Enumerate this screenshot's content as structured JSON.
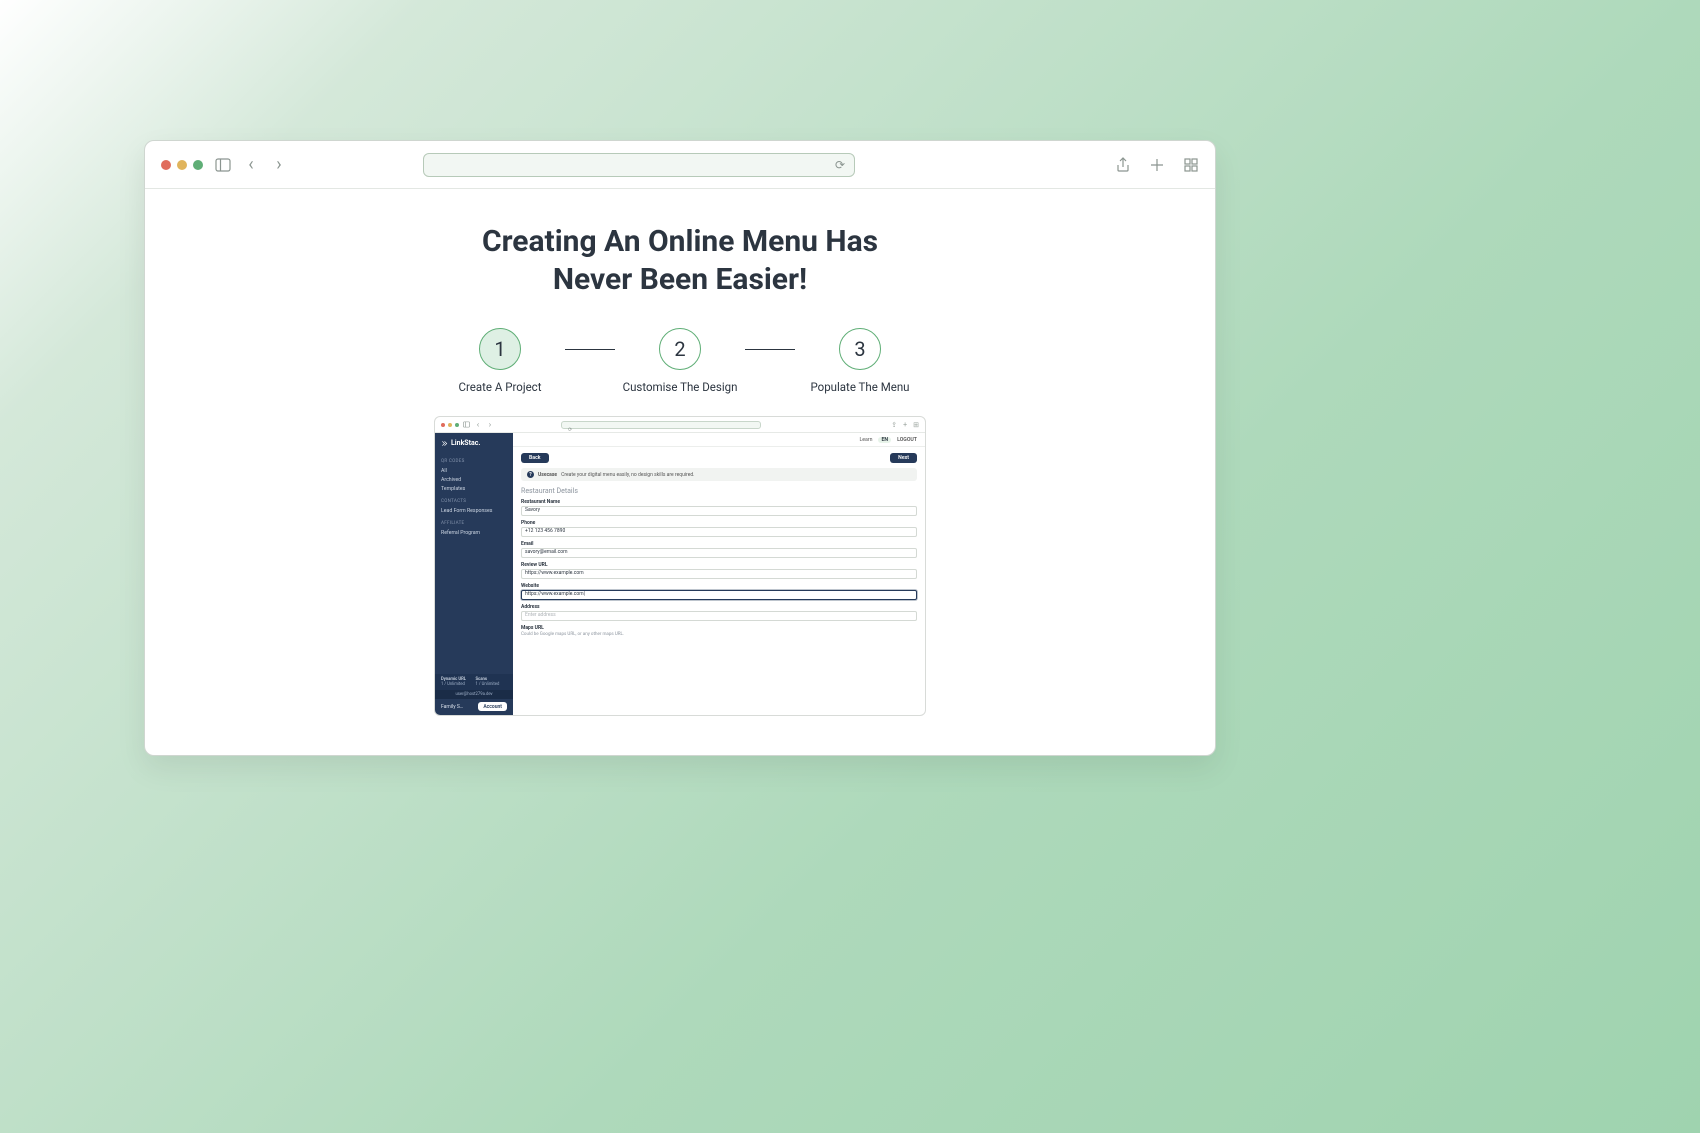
{
  "headline_line1": "Creating An Online Menu Has",
  "headline_line2": "Never Been Easier!",
  "steps": [
    {
      "num": "1",
      "label": "Create A Project",
      "active": true
    },
    {
      "num": "2",
      "label": "Customise The Design",
      "active": false
    },
    {
      "num": "3",
      "label": "Populate The Menu",
      "active": false
    }
  ],
  "inner": {
    "logo": "LinkStac.",
    "topbar": {
      "learn": "Learn",
      "lang": "EN",
      "logout": "LOGOUT"
    },
    "sidebar": {
      "sections": [
        {
          "heading": "QR CODES",
          "items": [
            "All",
            "Archived",
            "Templates"
          ]
        },
        {
          "heading": "CONTACTS",
          "items": [
            "Lead Form Responses"
          ]
        },
        {
          "heading": "AFFILIATE",
          "items": [
            "Referral Program"
          ]
        }
      ],
      "quota": {
        "left_label": "Dynamic URL",
        "left_value": "1 / Unlimited",
        "right_label": "Scans",
        "right_value": "1 / Unlimited"
      },
      "user": "user@host279a.dev",
      "family": "Family S…",
      "account": "Account"
    },
    "form": {
      "back": "Back",
      "next": "Next",
      "usecase_label": "Usecase",
      "usecase_text": "Create your digital menu easily, no design skills are required.",
      "section_title": "Restaurant Details",
      "fields": [
        {
          "label": "Restaurant Name",
          "value": "Savory"
        },
        {
          "label": "Phone",
          "value": "+12 123 456 7890"
        },
        {
          "label": "Email",
          "value": "savory@email.com"
        },
        {
          "label": "Review URL",
          "value": "https://www.example.com"
        },
        {
          "label": "Website",
          "value": "https://www.example.com|",
          "focused": true
        },
        {
          "label": "Address",
          "value": "",
          "placeholder": "Enter address"
        },
        {
          "label": "Maps URL",
          "value": "",
          "hint": "Could be Google maps URL, or any other maps URL."
        }
      ]
    }
  }
}
